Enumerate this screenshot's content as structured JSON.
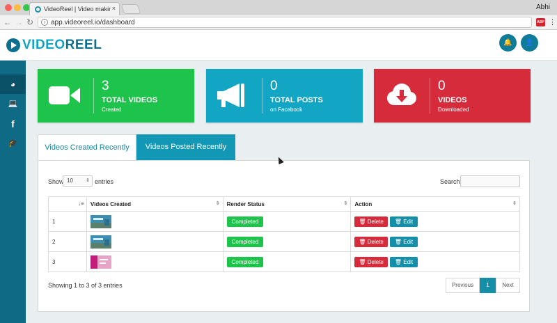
{
  "browser": {
    "tab_title": "VideoReel | Video making app",
    "tab_close": "×",
    "profile_name": "Abhi",
    "url": "app.videoreel.io/dashboard",
    "back": "←",
    "forward": "→",
    "reload": "↻",
    "ext_label": "ABP",
    "menu": "⋮"
  },
  "header": {
    "logo_left": "VIDEO",
    "logo_right": "REEL",
    "notification_icon": "🔔",
    "user_icon": "👤"
  },
  "sidebar": {
    "items": [
      {
        "name": "dashboard",
        "icon": "◕"
      },
      {
        "name": "computer",
        "icon": "💻"
      },
      {
        "name": "facebook",
        "icon": "f"
      },
      {
        "name": "tutorial",
        "icon": "🎓"
      }
    ]
  },
  "cards": [
    {
      "value": "3",
      "label": "TOTAL VIDEOS",
      "sub": "Created",
      "color": "#1ec34b"
    },
    {
      "value": "0",
      "label": "TOTAL POSTS",
      "sub": "on Facebook",
      "color": "#13a6c4"
    },
    {
      "value": "0",
      "label": "VIDEOS",
      "sub": "Downloaded",
      "color": "#d52b3b"
    }
  ],
  "tabs": {
    "created": "Videos Created Recently",
    "posted": "Videos Posted Recently"
  },
  "table_controls": {
    "show": "Show",
    "entries_value": "10",
    "entries": "entries",
    "search": "Search:"
  },
  "table": {
    "headers": [
      "",
      "Videos Created",
      "Render Status",
      "Action"
    ],
    "rows": [
      {
        "num": "1",
        "status": "Completed",
        "delete": "Delete",
        "edit": "Edit"
      },
      {
        "num": "2",
        "status": "Completed",
        "delete": "Delete",
        "edit": "Edit"
      },
      {
        "num": "3",
        "status": "Completed",
        "delete": "Delete",
        "edit": "Edit"
      }
    ]
  },
  "footer": {
    "info": "Showing 1 to 3 of 3 entries",
    "prev": "Previous",
    "page": "1",
    "next": "Next"
  }
}
